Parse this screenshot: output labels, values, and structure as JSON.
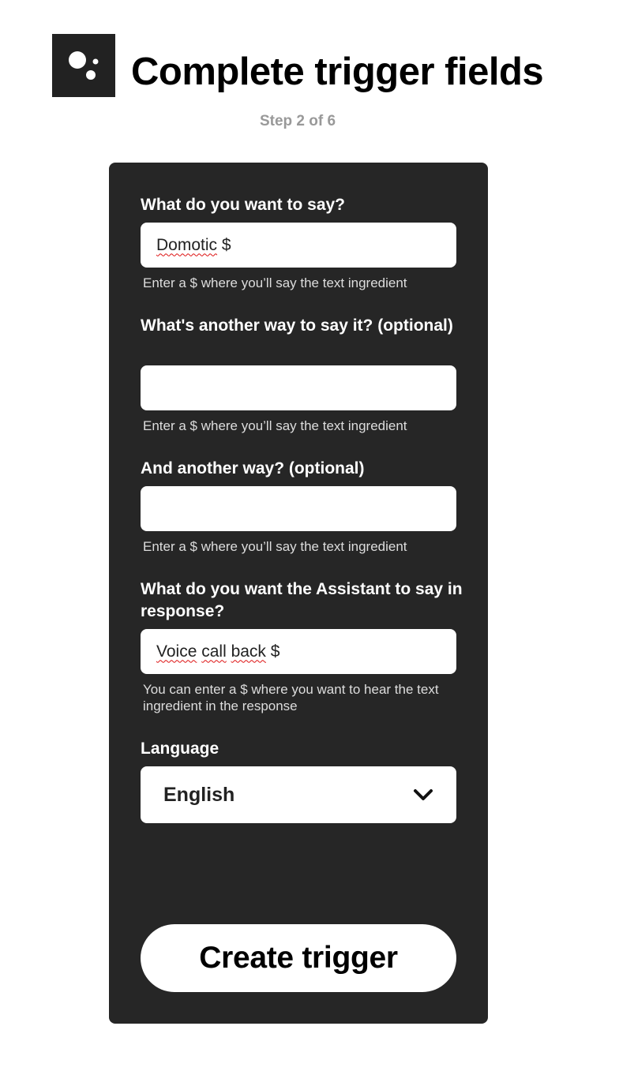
{
  "header": {
    "title": "Complete trigger fields",
    "step": "Step 2 of 6",
    "logo_icon": "google-assistant-icon"
  },
  "form": {
    "fields": [
      {
        "label": "What do you want to say?",
        "value_word": "Domotic",
        "value_rest": " $",
        "help": "Enter a $ where you’ll say the text ingredient"
      },
      {
        "label": "What's another way to say it? (optional)",
        "value": "",
        "help": "Enter a $ where you’ll say the text ingredient"
      },
      {
        "label": "And another way? (optional)",
        "value": "",
        "help": "Enter a $ where you’ll say the text ingredient"
      },
      {
        "label": "What do you want the Assistant to say in response?",
        "value_word1": "Voice",
        "value_word2": "call",
        "value_word3": "back",
        "value_rest": " $",
        "help": "You can enter a $ where you want to hear the text ingredient in the response"
      }
    ],
    "language": {
      "label": "Language",
      "selected": "English",
      "icon": "chevron-down-icon"
    },
    "submit_label": "Create trigger"
  },
  "colors": {
    "card_background": "#262626",
    "logo_background": "#222222",
    "step_text": "#999999",
    "page_background": "#ffffff"
  }
}
